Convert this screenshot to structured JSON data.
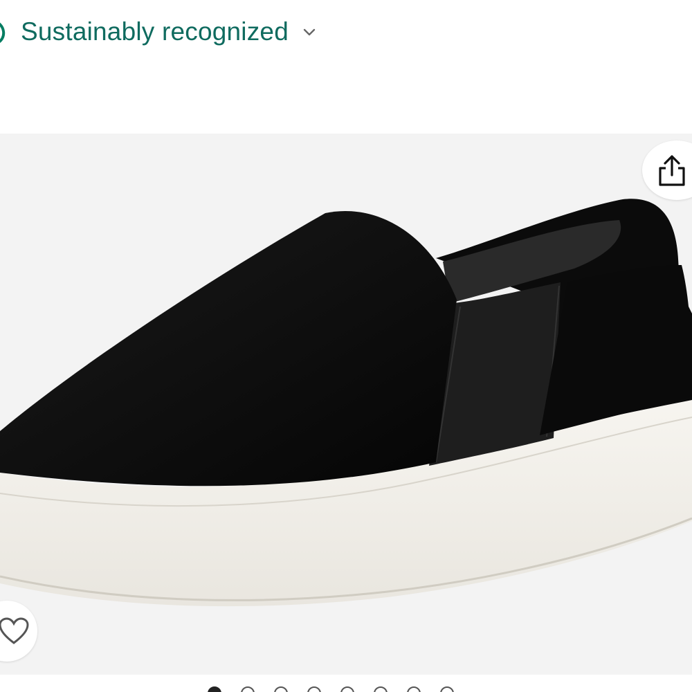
{
  "sustainability": {
    "label": "Sustainably recognized",
    "icon": "leaf-icon",
    "chevron_icon": "chevron-down-icon",
    "color": "#067D62"
  },
  "gallery": {
    "image_alt": "Black suede slip-on platform sneaker with white sole",
    "share_icon": "share-icon",
    "wishlist_icon": "heart-icon",
    "background": "#f3f3f3",
    "image_count": 8,
    "active_index": 0
  }
}
